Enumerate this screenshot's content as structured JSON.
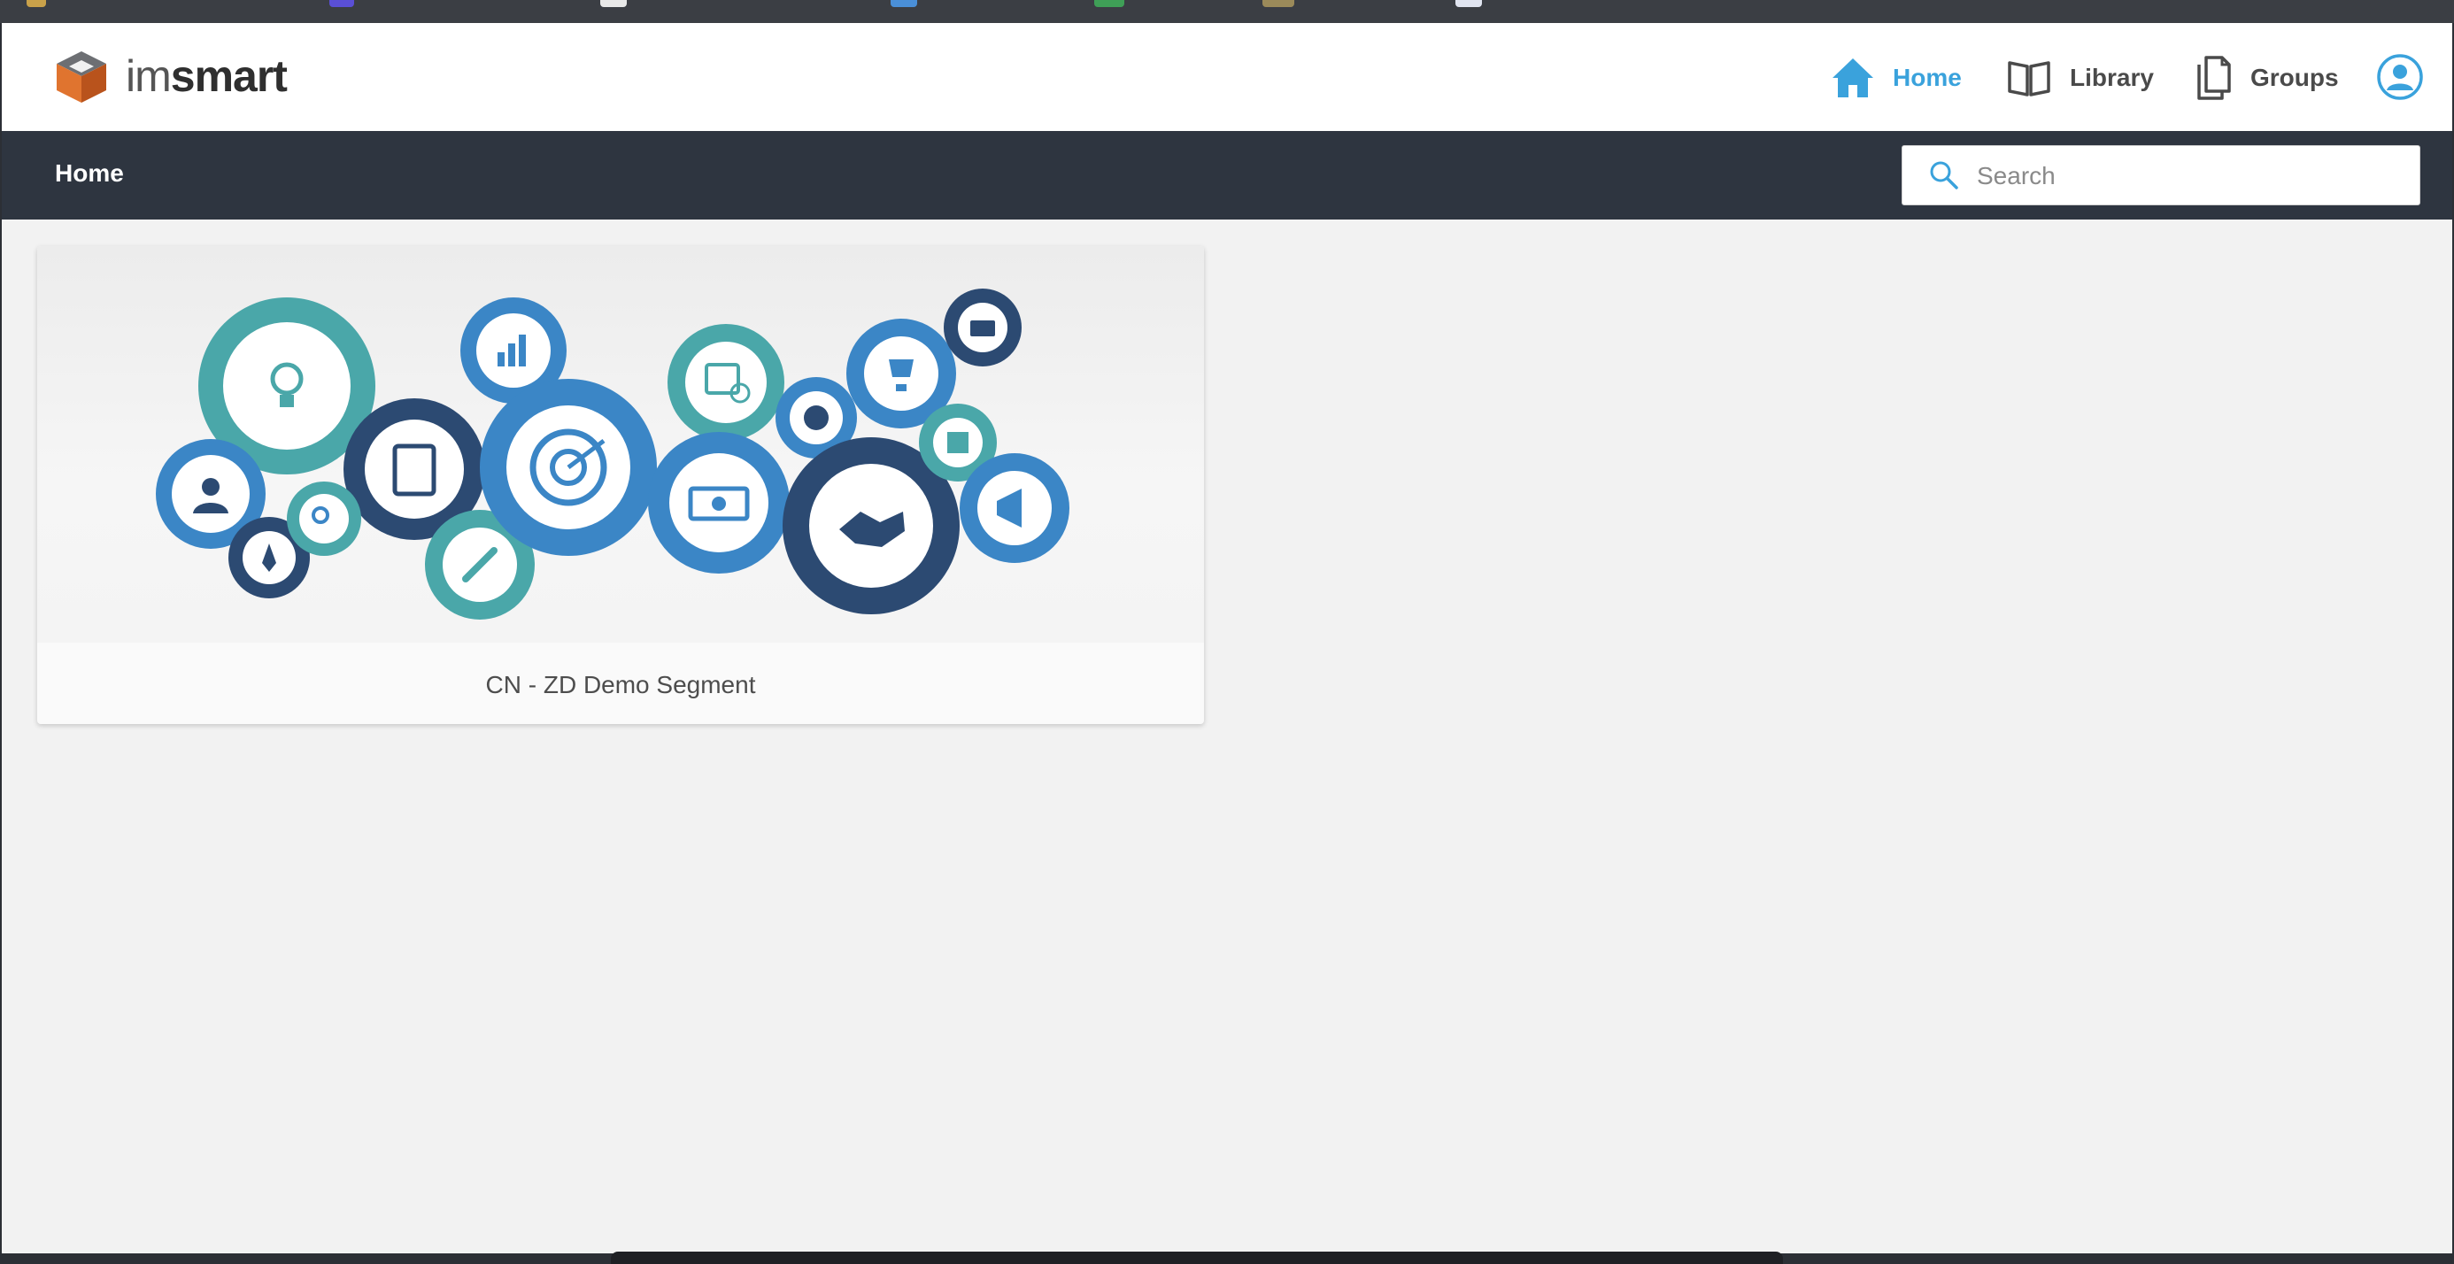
{
  "app": {
    "logo_text_light": "im",
    "logo_text_bold": "smart"
  },
  "nav": {
    "home": "Home",
    "library": "Library",
    "groups": "Groups"
  },
  "subbar": {
    "breadcrumb": "Home",
    "search_placeholder": "Search"
  },
  "cards": [
    {
      "title": "CN - ZD Demo Segment"
    }
  ],
  "colors": {
    "accent": "#3aa2dc",
    "subbar": "#2e3540",
    "gear_teal": "#4aa7a9",
    "gear_blue": "#3b86c6",
    "gear_navy": "#2c4a72"
  },
  "icons": {
    "logo": "cube-logo-icon",
    "home": "home-icon",
    "library": "book-icon",
    "groups": "documents-icon",
    "profile": "user-circle-icon",
    "search": "search-icon"
  }
}
